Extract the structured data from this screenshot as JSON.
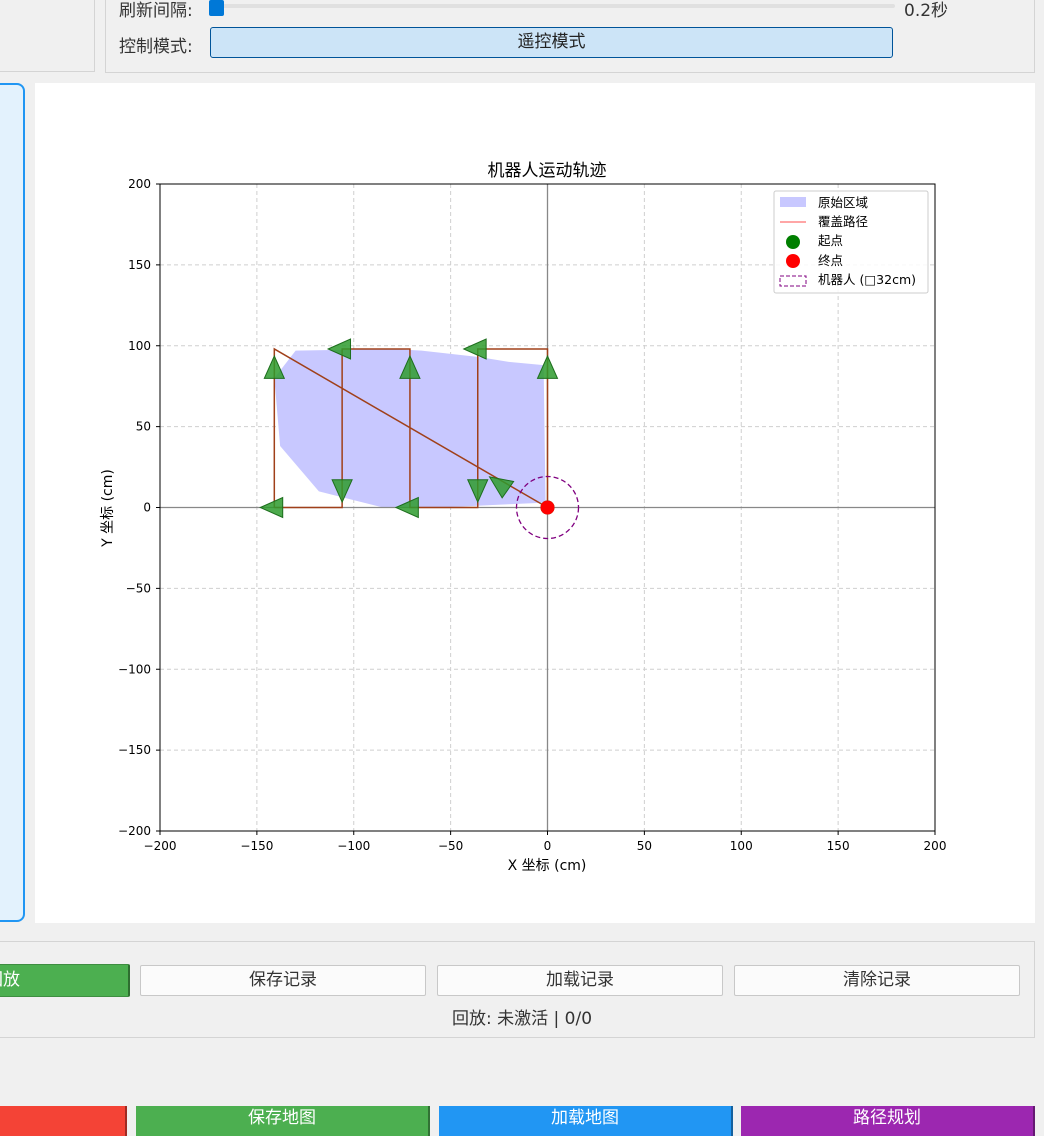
{
  "settings": {
    "refresh_label": "刷新间隔:",
    "refresh_value": "0.2秒",
    "refresh_fraction": 0.0,
    "mode_label": "控制模式:",
    "mode_value": "遥控模式"
  },
  "chart_data": {
    "type": "line",
    "title": "机器人运动轨迹",
    "xlabel": "X 坐标 (cm)",
    "ylabel": "Y 坐标 (cm)",
    "xlim": [
      -200,
      200
    ],
    "ylim": [
      -200,
      200
    ],
    "xticks": [
      -200,
      -150,
      -100,
      -50,
      0,
      50,
      100,
      150,
      200
    ],
    "yticks": [
      -200,
      -150,
      -100,
      -50,
      0,
      50,
      100,
      150,
      200
    ],
    "grid": true,
    "legend_position": "top-right",
    "legend": [
      "原始区域",
      "覆盖路径",
      "起点",
      "终点",
      "机器人 (□32cm)"
    ],
    "region_polygon": [
      [
        -130,
        97
      ],
      [
        -80,
        98
      ],
      [
        -65,
        97
      ],
      [
        -50,
        95
      ],
      [
        -35,
        93
      ],
      [
        -20,
        90
      ],
      [
        -2,
        88
      ],
      [
        -1,
        3
      ],
      [
        -20,
        2
      ],
      [
        -55,
        0
      ],
      [
        -85,
        0
      ],
      [
        -118,
        10
      ],
      [
        -138,
        38
      ],
      [
        -141,
        80
      ]
    ],
    "path": [
      [
        -141,
        0
      ],
      [
        -106,
        0
      ],
      [
        -106,
        98
      ],
      [
        -71,
        98
      ],
      [
        -71,
        0
      ],
      [
        -36,
        0
      ],
      [
        -36,
        98
      ],
      [
        0,
        98
      ],
      [
        0,
        0
      ],
      [
        -141,
        98
      ],
      [
        -141,
        0
      ]
    ],
    "start": [
      0,
      0
    ],
    "end": [
      0,
      0
    ],
    "robot_radius": 16,
    "headings": [
      {
        "x": -141,
        "y": 85,
        "dir": "up"
      },
      {
        "x": -106,
        "y": 98,
        "dir": "left"
      },
      {
        "x": -71,
        "y": 85,
        "dir": "up"
      },
      {
        "x": -36,
        "y": 98,
        "dir": "left"
      },
      {
        "x": 0,
        "y": 85,
        "dir": "up"
      },
      {
        "x": -141,
        "y": 0,
        "dir": "left"
      },
      {
        "x": -106,
        "y": 12,
        "dir": "down"
      },
      {
        "x": -71,
        "y": 0,
        "dir": "left"
      },
      {
        "x": -36,
        "y": 12,
        "dir": "down"
      },
      {
        "x": -24,
        "y": 14,
        "dir": "upleft"
      }
    ],
    "colors": {
      "region": "#c8c8ff",
      "path": "#ff4d4d",
      "path_drawn": "#a0401a",
      "start": "#007f00",
      "end": "#ff0000",
      "robot": "#800080",
      "arrow": "#2e9b2e"
    }
  },
  "records": {
    "play_label": "回放",
    "save_label": "保存记录",
    "load_label": "加载记录",
    "clear_label": "清除记录",
    "status": "回放: 未激活 | 0/0"
  },
  "bottom": {
    "stop_label": "",
    "save_map_label": "保存地图",
    "load_map_label": "加载地图",
    "plan_label": "路径规划"
  }
}
